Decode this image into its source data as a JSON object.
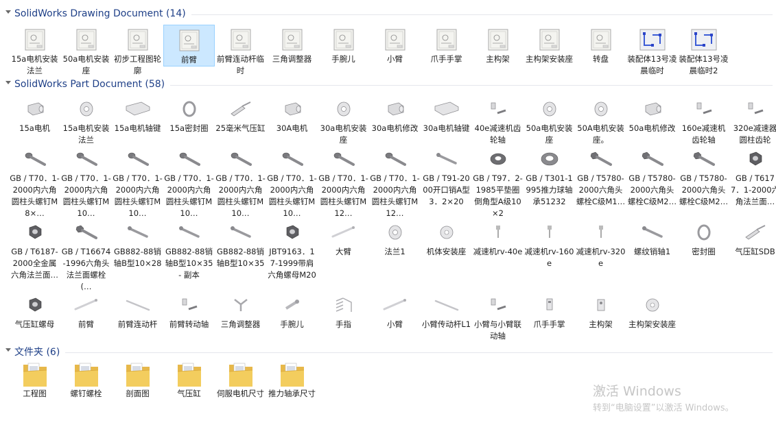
{
  "groups": [
    {
      "title": "SolidWorks Drawing Document (14)",
      "items": [
        {
          "label": "15a电机安装法兰",
          "icon": "drawing-icon"
        },
        {
          "label": "50a电机安装座",
          "icon": "drawing-icon"
        },
        {
          "label": "初步工程图轮廓",
          "icon": "drawing-icon"
        },
        {
          "label": "前臂",
          "icon": "drawing-icon",
          "selected": true
        },
        {
          "label": "前臂连动杆临时",
          "icon": "drawing-icon"
        },
        {
          "label": "三角调整器",
          "icon": "drawing-icon"
        },
        {
          "label": "手腕儿",
          "icon": "drawing-icon"
        },
        {
          "label": "小臂",
          "icon": "drawing-icon"
        },
        {
          "label": "爪手手掌",
          "icon": "drawing-icon"
        },
        {
          "label": "主构架",
          "icon": "drawing-icon"
        },
        {
          "label": "主构架安装座",
          "icon": "drawing-icon"
        },
        {
          "label": "转盘",
          "icon": "drawing-icon"
        },
        {
          "label": "装配体13号凌晨临时",
          "icon": "assembly-drawing-icon"
        },
        {
          "label": "装配体13号凌晨临时2",
          "icon": "assembly-drawing-icon"
        }
      ]
    },
    {
      "title": "SolidWorks Part Document (58)",
      "items": [
        {
          "label": "15a电机",
          "icon": "motor-part-icon"
        },
        {
          "label": "15a电机安装法兰",
          "icon": "flange-part-icon"
        },
        {
          "label": "15a电机轴键",
          "icon": "key-part-icon"
        },
        {
          "label": "15a密封圈",
          "icon": "ring-part-icon"
        },
        {
          "label": "25毫米气压缸",
          "icon": "cylinder-part-icon"
        },
        {
          "label": "30A电机",
          "icon": "motor-part-icon"
        },
        {
          "label": "30a电机安装座",
          "icon": "flange-part-icon"
        },
        {
          "label": "30a电机修改",
          "icon": "motor-part-icon"
        },
        {
          "label": "30a电机轴键",
          "icon": "key-part-icon"
        },
        {
          "label": "40e减速机齿轮轴",
          "icon": "shaft-part-icon"
        },
        {
          "label": "50a电机安装座",
          "icon": "flange-part-icon"
        },
        {
          "label": "50A电机安装座。",
          "icon": "flange-part-icon"
        },
        {
          "label": "50a电机修改",
          "icon": "motor-part-icon"
        },
        {
          "label": "160e减速机齿轮轴",
          "icon": "shaft-part-icon"
        },
        {
          "label": "320e减速器圆柱齿轮",
          "icon": "shaft-part-icon"
        },
        {
          "label": "GB / T70．1-2000内六角圆柱头螺钉M8×…",
          "icon": "screw-part-icon"
        },
        {
          "label": "GB / T70．1-2000内六角圆柱头螺钉M10…",
          "icon": "screw-part-icon"
        },
        {
          "label": "GB / T70．1-2000内六角圆柱头螺钉M10…",
          "icon": "screw-part-icon"
        },
        {
          "label": "GB / T70．1-2000内六角圆柱头螺钉M10…",
          "icon": "screw-part-icon"
        },
        {
          "label": "GB / T70．1-2000内六角圆柱头螺钉M10…",
          "icon": "screw-part-icon"
        },
        {
          "label": "GB / T70．1-2000内六角圆柱头螺钉M10…",
          "icon": "screw-part-icon"
        },
        {
          "label": "GB / T70．1-2000内六角圆柱头螺钉M12…",
          "icon": "screw-part-icon"
        },
        {
          "label": "GB / T70．1-2000内六角圆柱头螺钉M12…",
          "icon": "screw-part-icon"
        },
        {
          "label": "GB / T91-2000开口销A型3．2×20",
          "icon": "pin-part-icon"
        },
        {
          "label": "GB / T97．2-1985平垫圈倒角型A级10×2",
          "icon": "washer-part-icon"
        },
        {
          "label": "GB / T301-1995推力球轴承51232",
          "icon": "bearing-part-icon"
        },
        {
          "label": "GB / T5780-2000六角头螺栓C级M1…",
          "icon": "bolt-part-icon"
        },
        {
          "label": "GB / T5780-2000六角头螺栓C级M2…",
          "icon": "bolt-part-icon"
        },
        {
          "label": "GB / T5780-2000六角头螺栓C级M2…",
          "icon": "bolt-part-icon"
        },
        {
          "label": "GB / T6177．1-2000六角法兰面…",
          "icon": "nut-part-icon"
        },
        {
          "label": "GB / T6187-2000全金属六角法兰面…",
          "icon": "nut-part-icon"
        },
        {
          "label": "GB / T16674-1996六角头法兰面螺栓(…",
          "icon": "bolt-part-icon"
        },
        {
          "label": "GB882-88销轴B型10×28",
          "icon": "pin-part-icon"
        },
        {
          "label": "GB882-88销轴B型10×35 - 副本",
          "icon": "pin-part-icon"
        },
        {
          "label": "GB882-88销轴B型10×35",
          "icon": "pin-part-icon"
        },
        {
          "label": "JBT9163．17-1999带肩六角螺母M20",
          "icon": "nut-part-icon"
        },
        {
          "label": "大臂",
          "icon": "arm-part-icon"
        },
        {
          "label": "法兰1",
          "icon": "flange-part-icon"
        },
        {
          "label": "机体安装座",
          "icon": "base-part-icon"
        },
        {
          "label": "减速机rv-40e",
          "icon": "reducer-part-icon"
        },
        {
          "label": "减速机rv-160e",
          "icon": "reducer-part-icon"
        },
        {
          "label": "减速机rv-320e",
          "icon": "reducer-part-icon"
        },
        {
          "label": "螺纹销轴1",
          "icon": "pin-part-icon"
        },
        {
          "label": "密封圈",
          "icon": "ring-part-icon"
        },
        {
          "label": "气压缸SDB",
          "icon": "cylinder-part-icon"
        },
        {
          "label": "气压缸螺母",
          "icon": "nut-part-icon"
        },
        {
          "label": "前臂",
          "icon": "arm-part-icon"
        },
        {
          "label": "前臂连动杆",
          "icon": "rod-part-icon"
        },
        {
          "label": "前臂转动轴",
          "icon": "shaft-part-icon"
        },
        {
          "label": "三角调整器",
          "icon": "bracket-part-icon"
        },
        {
          "label": "手腕儿",
          "icon": "wrist-part-icon"
        },
        {
          "label": "手指",
          "icon": "finger-part-icon"
        },
        {
          "label": "小臂",
          "icon": "arm-part-icon"
        },
        {
          "label": "小臂传动杆L1",
          "icon": "rod-part-icon"
        },
        {
          "label": "小臂与小臂联动轴",
          "icon": "shaft-part-icon"
        },
        {
          "label": "爪手手掌",
          "icon": "palm-part-icon"
        },
        {
          "label": "主构架",
          "icon": "frame-part-icon"
        },
        {
          "label": "主构架安装座",
          "icon": "base-part-icon"
        }
      ]
    },
    {
      "title": "文件夹 (6)",
      "items": [
        {
          "label": "工程图",
          "icon": "folder-icon"
        },
        {
          "label": "螺钉螺栓",
          "icon": "folder-icon"
        },
        {
          "label": "剖面图",
          "icon": "folder-icon"
        },
        {
          "label": "气压缸",
          "icon": "folder-icon"
        },
        {
          "label": "伺服电机尺寸",
          "icon": "folder-icon"
        },
        {
          "label": "推力轴承尺寸",
          "icon": "folder-icon"
        }
      ]
    }
  ],
  "watermark": {
    "line1": "激活 Windows",
    "line2": "转到“电脑设置”以激活 Windows。"
  },
  "colors": {
    "group_title": "#1e3f87",
    "selection_bg": "#cce8ff",
    "selection_border": "#99d1ff",
    "folder": "#f2c94c"
  }
}
